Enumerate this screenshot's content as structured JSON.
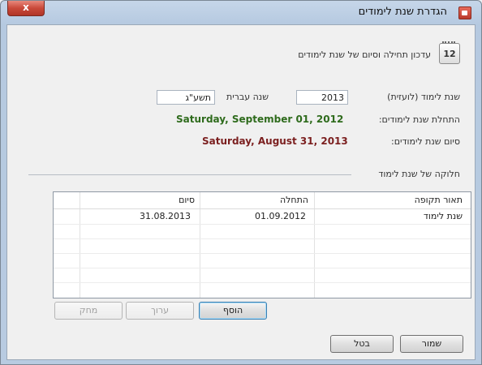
{
  "window": {
    "title": "הגדרת שנת לימודים",
    "close_label": "x"
  },
  "header": {
    "icon_text": "12",
    "description": "עדכון תחילה וסיום של שנת לימודים"
  },
  "fields": {
    "school_year_label": "שנת לימוד (לועזית)",
    "school_year_value": "2013",
    "hebrew_year_label": "שנה עברית",
    "hebrew_year_value": "תשע\"ג",
    "start_label": "התחלת שנת לימודים:",
    "start_value": "Saturday, September 01, 2012",
    "end_label": "סיום שנת לימודים:",
    "end_value": "Saturday, August 31, 2013"
  },
  "section": {
    "title": "חלוקה של שנת לימוד"
  },
  "table": {
    "columns": [
      "תאור תקופה",
      "התחלה",
      "סיום"
    ],
    "rows": [
      [
        "שנת לימוד",
        "01.09.2012",
        "31.08.2013"
      ]
    ]
  },
  "buttons": {
    "add": "הוסף",
    "edit": "ערוך",
    "delete": "מחק",
    "save": "שמור",
    "cancel": "בטל"
  },
  "icons": {
    "title_icon": "app-icon",
    "calendar_icon": "calendar-icon",
    "close_icon": "close-icon"
  },
  "colors": {
    "start_date": "#2e6b1c",
    "end_date": "#7b1f1f"
  }
}
